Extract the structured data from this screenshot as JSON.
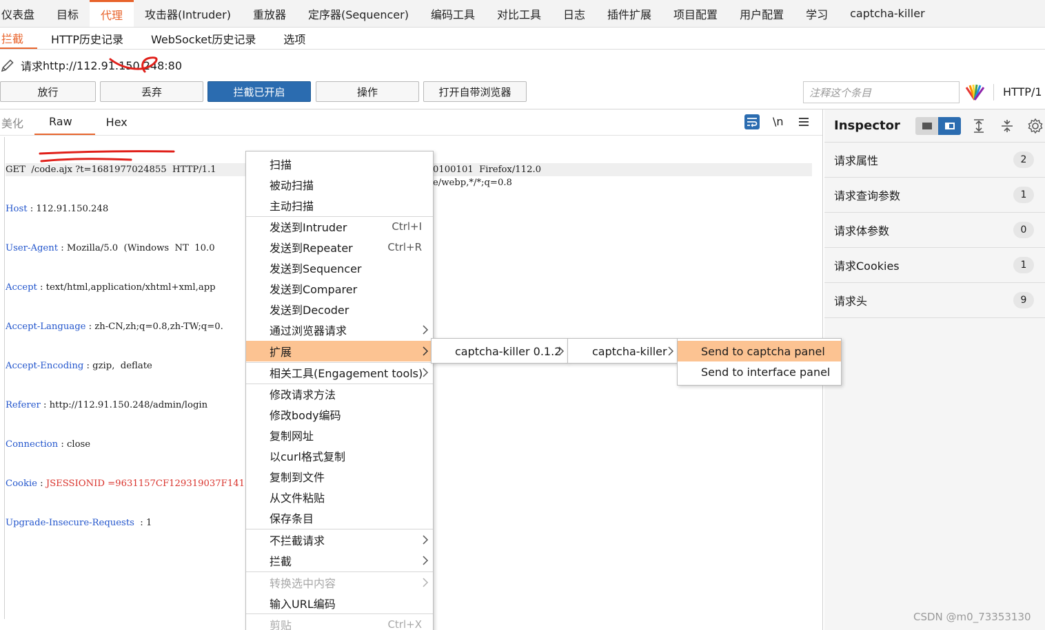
{
  "top_nav": [
    "仪表盘",
    "目标",
    "代理",
    "攻击器(Intruder)",
    "重放器",
    "定序器(Sequencer)",
    "编码工具",
    "对比工具",
    "日志",
    "插件扩展",
    "项目配置",
    "用户配置",
    "学习",
    "captcha-killer"
  ],
  "top_nav_active": "代理",
  "sub_nav": [
    "拦截",
    "HTTP历史记录",
    "WebSocket历史记录",
    "选项"
  ],
  "sub_nav_active": "拦截",
  "request_line": {
    "prefix": "请求",
    "url": "http://112.91.150.248:80"
  },
  "actions": {
    "forward": "放行",
    "drop": "丢弃",
    "intercept_on": "拦截已开启",
    "action": "操作",
    "open_browser": "打开自带浏览器",
    "annotate_placeholder": "注释这个条目",
    "http_version": "HTTP/1"
  },
  "editor_tabs": [
    "美化",
    "Raw",
    "Hex"
  ],
  "editor_tab_active": "Raw",
  "editor_tools": {
    "newline": "\\n"
  },
  "raw_lines": [
    {
      "key": "GET",
      "sep": "  ",
      "value": "/code.ajx ?t=1681977024855  HTTP/1.1"
    },
    {
      "key": "Host",
      "sep": " : ",
      "value": "112.91.150.248"
    },
    {
      "key": "User-Agent",
      "sep": " : ",
      "value": "Mozilla/5.0  (Windows  NT  10.0"
    },
    {
      "key": "Accept",
      "sep": " : ",
      "value": "text/html,application/xhtml+xml,app"
    },
    {
      "key": "Accept-Language",
      "sep": " : ",
      "value": "zh-CN,zh;q=0.8,zh-TW;q=0."
    },
    {
      "key": "Accept-Encoding",
      "sep": " : ",
      "value": "gzip,  deflate"
    },
    {
      "key": "Referer",
      "sep": " : ",
      "value": "http://112.91.150.248/admin/login"
    },
    {
      "key": "Connection",
      "sep": " : ",
      "value": "close"
    },
    {
      "key": "Cookie",
      "sep": " : ",
      "value": "JSESSIONID =9631157CF129319037F141"
    },
    {
      "key": "Upgrade-Insecure-Requests",
      "sep": "  : ",
      "value": "1"
    }
  ],
  "raw_overflow": [
    "",
    "",
    "0100101  Firefox/112.0",
    "e/webp,*/*;q=0.8"
  ],
  "inspector": {
    "title": "Inspector",
    "rows": [
      {
        "label": "请求属性",
        "count": "2"
      },
      {
        "label": "请求查询参数",
        "count": "1"
      },
      {
        "label": "请求体参数",
        "count": "0"
      },
      {
        "label": "请求Cookies",
        "count": "1"
      },
      {
        "label": "请求头",
        "count": "9"
      }
    ]
  },
  "context_menu": [
    {
      "label": "扫描"
    },
    {
      "label": "被动扫描"
    },
    {
      "label": "主动扫描"
    },
    {
      "label": "发送到Intruder",
      "shortcut": "Ctrl+I"
    },
    {
      "label": "发送到Repeater",
      "shortcut": "Ctrl+R"
    },
    {
      "label": "发送到Sequencer"
    },
    {
      "label": "发送到Comparer"
    },
    {
      "label": "发送到Decoder"
    },
    {
      "label": "通过浏览器请求"
    },
    {
      "label": "扩展"
    },
    {
      "label": "相关工具(Engagement tools)"
    },
    {
      "label": "修改请求方法"
    },
    {
      "label": "修改body编码"
    },
    {
      "label": "复制网址"
    },
    {
      "label": "以curl格式复制"
    },
    {
      "label": "复制到文件"
    },
    {
      "label": "从文件粘贴"
    },
    {
      "label": "保存条目"
    },
    {
      "label": "不拦截请求"
    },
    {
      "label": "拦截"
    },
    {
      "label": "转换选中内容"
    },
    {
      "label": "输入URL编码"
    },
    {
      "label": "剪贴",
      "shortcut": "Ctrl+X"
    }
  ],
  "submenu_1": {
    "label": "captcha-killer 0.1.2"
  },
  "submenu_2": {
    "label": "captcha-killer"
  },
  "submenu_3": [
    "Send to captcha panel",
    "Send to interface panel"
  ],
  "watermark": "CSDN @m0_73353130",
  "colors": {
    "accent": "#e8632b",
    "primary_button": "#2b6cb0",
    "menu_highlight": "#fcc392",
    "key_text": "#2255cc",
    "value_text": "#d9322b",
    "annotation_red": "#e0201a"
  }
}
